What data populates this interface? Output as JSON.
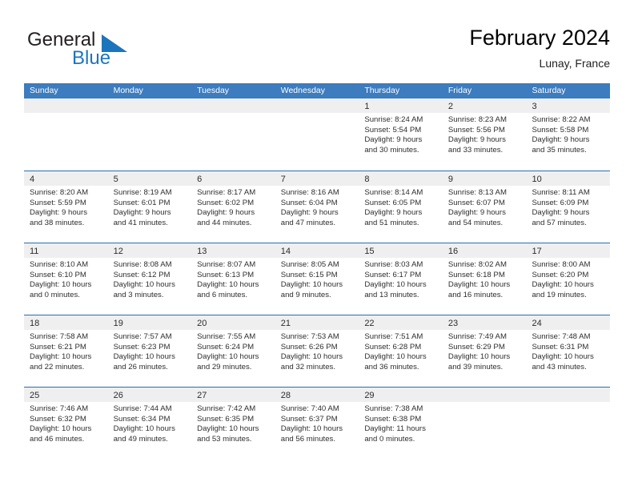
{
  "brand": {
    "word_general": "General",
    "word_blue": "Blue",
    "flag_icon": "triangle-flag-icon"
  },
  "header": {
    "title": "February 2024",
    "location": "Lunay, France"
  },
  "colors": {
    "header_blue": "#3c7cbf",
    "rule_blue": "#2a6ead",
    "band_gray": "#efefef",
    "brand_blue": "#1c75bc",
    "text": "#2e2e2e"
  },
  "weekdays": [
    "Sunday",
    "Monday",
    "Tuesday",
    "Wednesday",
    "Thursday",
    "Friday",
    "Saturday"
  ],
  "weeks": [
    [
      {
        "day": "",
        "lines": []
      },
      {
        "day": "",
        "lines": []
      },
      {
        "day": "",
        "lines": []
      },
      {
        "day": "",
        "lines": []
      },
      {
        "day": "1",
        "lines": [
          "Sunrise: 8:24 AM",
          "Sunset: 5:54 PM",
          "Daylight: 9 hours",
          "and 30 minutes."
        ]
      },
      {
        "day": "2",
        "lines": [
          "Sunrise: 8:23 AM",
          "Sunset: 5:56 PM",
          "Daylight: 9 hours",
          "and 33 minutes."
        ]
      },
      {
        "day": "3",
        "lines": [
          "Sunrise: 8:22 AM",
          "Sunset: 5:58 PM",
          "Daylight: 9 hours",
          "and 35 minutes."
        ]
      }
    ],
    [
      {
        "day": "4",
        "lines": [
          "Sunrise: 8:20 AM",
          "Sunset: 5:59 PM",
          "Daylight: 9 hours",
          "and 38 minutes."
        ]
      },
      {
        "day": "5",
        "lines": [
          "Sunrise: 8:19 AM",
          "Sunset: 6:01 PM",
          "Daylight: 9 hours",
          "and 41 minutes."
        ]
      },
      {
        "day": "6",
        "lines": [
          "Sunrise: 8:17 AM",
          "Sunset: 6:02 PM",
          "Daylight: 9 hours",
          "and 44 minutes."
        ]
      },
      {
        "day": "7",
        "lines": [
          "Sunrise: 8:16 AM",
          "Sunset: 6:04 PM",
          "Daylight: 9 hours",
          "and 47 minutes."
        ]
      },
      {
        "day": "8",
        "lines": [
          "Sunrise: 8:14 AM",
          "Sunset: 6:05 PM",
          "Daylight: 9 hours",
          "and 51 minutes."
        ]
      },
      {
        "day": "9",
        "lines": [
          "Sunrise: 8:13 AM",
          "Sunset: 6:07 PM",
          "Daylight: 9 hours",
          "and 54 minutes."
        ]
      },
      {
        "day": "10",
        "lines": [
          "Sunrise: 8:11 AM",
          "Sunset: 6:09 PM",
          "Daylight: 9 hours",
          "and 57 minutes."
        ]
      }
    ],
    [
      {
        "day": "11",
        "lines": [
          "Sunrise: 8:10 AM",
          "Sunset: 6:10 PM",
          "Daylight: 10 hours",
          "and 0 minutes."
        ]
      },
      {
        "day": "12",
        "lines": [
          "Sunrise: 8:08 AM",
          "Sunset: 6:12 PM",
          "Daylight: 10 hours",
          "and 3 minutes."
        ]
      },
      {
        "day": "13",
        "lines": [
          "Sunrise: 8:07 AM",
          "Sunset: 6:13 PM",
          "Daylight: 10 hours",
          "and 6 minutes."
        ]
      },
      {
        "day": "14",
        "lines": [
          "Sunrise: 8:05 AM",
          "Sunset: 6:15 PM",
          "Daylight: 10 hours",
          "and 9 minutes."
        ]
      },
      {
        "day": "15",
        "lines": [
          "Sunrise: 8:03 AM",
          "Sunset: 6:17 PM",
          "Daylight: 10 hours",
          "and 13 minutes."
        ]
      },
      {
        "day": "16",
        "lines": [
          "Sunrise: 8:02 AM",
          "Sunset: 6:18 PM",
          "Daylight: 10 hours",
          "and 16 minutes."
        ]
      },
      {
        "day": "17",
        "lines": [
          "Sunrise: 8:00 AM",
          "Sunset: 6:20 PM",
          "Daylight: 10 hours",
          "and 19 minutes."
        ]
      }
    ],
    [
      {
        "day": "18",
        "lines": [
          "Sunrise: 7:58 AM",
          "Sunset: 6:21 PM",
          "Daylight: 10 hours",
          "and 22 minutes."
        ]
      },
      {
        "day": "19",
        "lines": [
          "Sunrise: 7:57 AM",
          "Sunset: 6:23 PM",
          "Daylight: 10 hours",
          "and 26 minutes."
        ]
      },
      {
        "day": "20",
        "lines": [
          "Sunrise: 7:55 AM",
          "Sunset: 6:24 PM",
          "Daylight: 10 hours",
          "and 29 minutes."
        ]
      },
      {
        "day": "21",
        "lines": [
          "Sunrise: 7:53 AM",
          "Sunset: 6:26 PM",
          "Daylight: 10 hours",
          "and 32 minutes."
        ]
      },
      {
        "day": "22",
        "lines": [
          "Sunrise: 7:51 AM",
          "Sunset: 6:28 PM",
          "Daylight: 10 hours",
          "and 36 minutes."
        ]
      },
      {
        "day": "23",
        "lines": [
          "Sunrise: 7:49 AM",
          "Sunset: 6:29 PM",
          "Daylight: 10 hours",
          "and 39 minutes."
        ]
      },
      {
        "day": "24",
        "lines": [
          "Sunrise: 7:48 AM",
          "Sunset: 6:31 PM",
          "Daylight: 10 hours",
          "and 43 minutes."
        ]
      }
    ],
    [
      {
        "day": "25",
        "lines": [
          "Sunrise: 7:46 AM",
          "Sunset: 6:32 PM",
          "Daylight: 10 hours",
          "and 46 minutes."
        ]
      },
      {
        "day": "26",
        "lines": [
          "Sunrise: 7:44 AM",
          "Sunset: 6:34 PM",
          "Daylight: 10 hours",
          "and 49 minutes."
        ]
      },
      {
        "day": "27",
        "lines": [
          "Sunrise: 7:42 AM",
          "Sunset: 6:35 PM",
          "Daylight: 10 hours",
          "and 53 minutes."
        ]
      },
      {
        "day": "28",
        "lines": [
          "Sunrise: 7:40 AM",
          "Sunset: 6:37 PM",
          "Daylight: 10 hours",
          "and 56 minutes."
        ]
      },
      {
        "day": "29",
        "lines": [
          "Sunrise: 7:38 AM",
          "Sunset: 6:38 PM",
          "Daylight: 11 hours",
          "and 0 minutes."
        ]
      },
      {
        "day": "",
        "lines": []
      },
      {
        "day": "",
        "lines": []
      }
    ]
  ]
}
